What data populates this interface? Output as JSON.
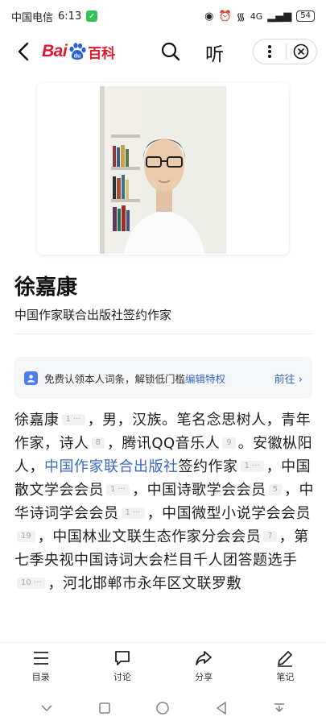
{
  "status_bar": {
    "carrier": "中国电信",
    "time": "6:13",
    "network": "4G",
    "battery": "54"
  },
  "nav": {
    "logo_text_left": "Bai",
    "logo_text_mid": "du",
    "logo_text_right": "百科",
    "listen_label": "听",
    "brand_color": "#e0182d"
  },
  "entry": {
    "name": "徐嘉康",
    "subtitle": "中国作家联合出版社签约作家"
  },
  "claim_banner": {
    "text": "免费认领本人词条，解锁低门槛",
    "link": "编辑特权",
    "action": "前往"
  },
  "body": {
    "t1": "徐嘉康",
    "r1": "1 ···",
    "t2": "，男，汉族。笔名念思树人，青年作家，诗人",
    "r2": "8",
    "t3": "，腾讯QQ音乐人",
    "r3": "9",
    "t4": "。安徽枞阳人，",
    "link1": "中国作家联合出版社",
    "t5": "签约作家",
    "r4": "1 ···",
    "t6": "，中国散文学会会员",
    "r5": "1 ···",
    "t7": "，中国诗歌学会会员",
    "r6": "5",
    "t8": "，中华诗词学会会员",
    "r7": "1 ···",
    "t9": "，中国微型小说学会会员",
    "r8": "19",
    "t10": "，中国林业文联生态作家分会会员",
    "r9": "7",
    "t11": "，第七季央视中国诗词大会栏目千人团答题选手",
    "r10": "10 ···",
    "t12": "，河北邯郸市永年区文联罗敷"
  },
  "toolbar": {
    "toc": "目录",
    "discuss": "讨论",
    "share": "分享",
    "note": "笔记"
  }
}
